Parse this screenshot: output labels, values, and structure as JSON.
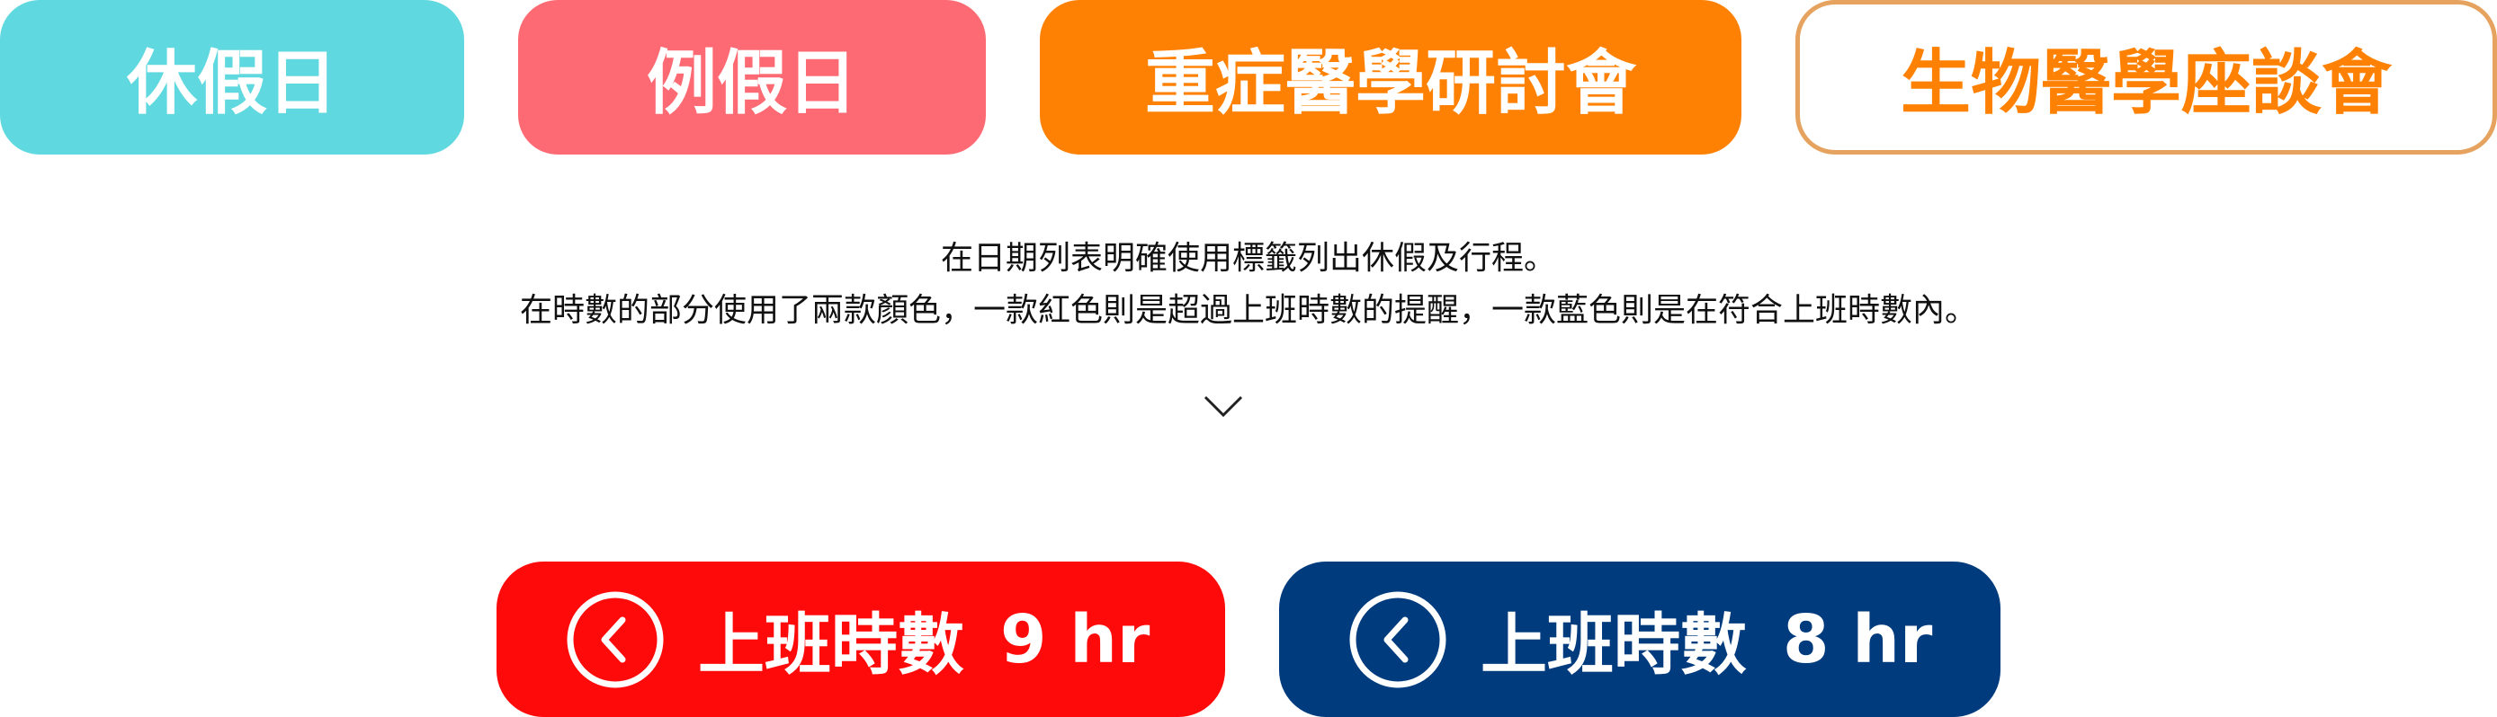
{
  "tags": {
    "holiday": "休假日",
    "regular_holiday": "例假日",
    "critical_care_seminar": "重症醫學研討會",
    "biomedical_seminar": "生物醫學座談會"
  },
  "description": {
    "line1": "在日期列表明確使用標籤列出休假及行程。",
    "line2": "在時數的部分使用了兩款顏色，一款紅色則是超過上班時數的提醒，一款藍色則是在符合上班時數內。"
  },
  "work_hours": {
    "over": {
      "label": "上班時數",
      "hours": "9 hr",
      "color": "#fe0a0a"
    },
    "within": {
      "label": "上班時數",
      "hours": "8 hr",
      "color": "#003b7e"
    }
  },
  "icons": {
    "expand": "chevron-down-icon",
    "back": "chevron-left-circle-icon"
  },
  "colors": {
    "holiday": "#5fd9df",
    "regular_holiday": "#fd6a73",
    "critical_care": "#fe8103",
    "biomedical_border": "#e6a25f"
  }
}
